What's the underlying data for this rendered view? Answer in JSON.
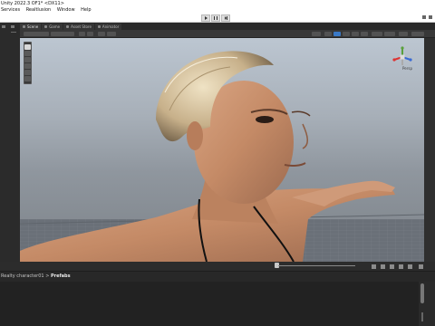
{
  "window": {
    "title": "Unity 2022.3 OF1* <DX11>"
  },
  "menu": {
    "items": [
      "Services",
      "Realtlusion",
      "Window",
      "Help"
    ]
  },
  "tabs": [
    {
      "label": "Scene"
    },
    {
      "label": "Game"
    },
    {
      "label": "Asset Store"
    },
    {
      "label": "Animator"
    }
  ],
  "scene": {
    "toolbar": {
      "shading_label": "Center",
      "space_label": "Local"
    },
    "gizmo": {
      "label": "Persp"
    }
  },
  "project": {
    "breadcrumb": [
      "Realty character01",
      "Prefabs"
    ]
  },
  "colors": {
    "sky_top": "#bcc6d1",
    "sky_bottom": "#7d8389",
    "floor": "#6a7078",
    "accent": "#3a79c6"
  }
}
